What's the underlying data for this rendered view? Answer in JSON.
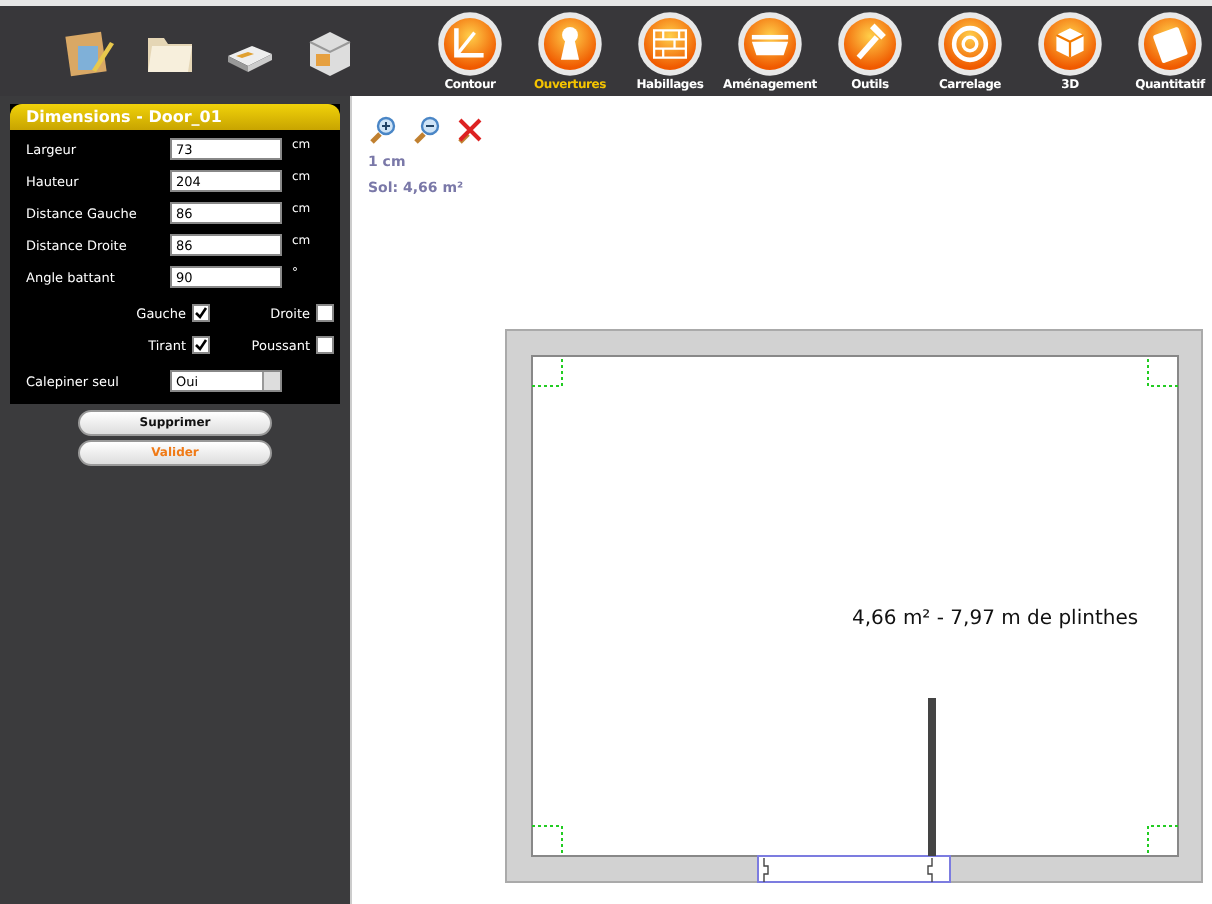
{
  "modules": [
    {
      "label": "Contour",
      "selected": false
    },
    {
      "label": "Ouvertures",
      "selected": true
    },
    {
      "label": "Habillages",
      "selected": false
    },
    {
      "label": "Aménagement",
      "selected": false
    },
    {
      "label": "Outils",
      "selected": false
    },
    {
      "label": "Carrelage",
      "selected": false
    },
    {
      "label": "3D",
      "selected": false
    },
    {
      "label": "Quantitatif",
      "selected": false
    }
  ],
  "panel": {
    "title": "Dimensions - Door_01",
    "fields": [
      {
        "label": "Largeur",
        "value": "73",
        "unit": "cm"
      },
      {
        "label": "Hauteur",
        "value": "204",
        "unit": "cm"
      },
      {
        "label": "Distance Gauche",
        "value": "86",
        "unit": "cm"
      },
      {
        "label": "Distance Droite",
        "value": "86",
        "unit": "cm"
      },
      {
        "label": "Angle battant",
        "value": "90",
        "unit": "°"
      }
    ],
    "checkboxes": [
      {
        "label": "Gauche",
        "checked": true
      },
      {
        "label": "Droite",
        "checked": false
      },
      {
        "label": "Tirant",
        "checked": true
      },
      {
        "label": "Poussant",
        "checked": false
      }
    ],
    "select": {
      "label": "Calepiner seul",
      "value": "Oui"
    },
    "buttons": [
      {
        "label": "Supprimer",
        "kind": "delete"
      },
      {
        "label": "Valider",
        "kind": "confirm"
      }
    ]
  },
  "canvas": {
    "scale": "1 cm",
    "area": "Sol: 4,66 m²",
    "room_label": "4,66 m² - 7,97 m de plinthes"
  }
}
